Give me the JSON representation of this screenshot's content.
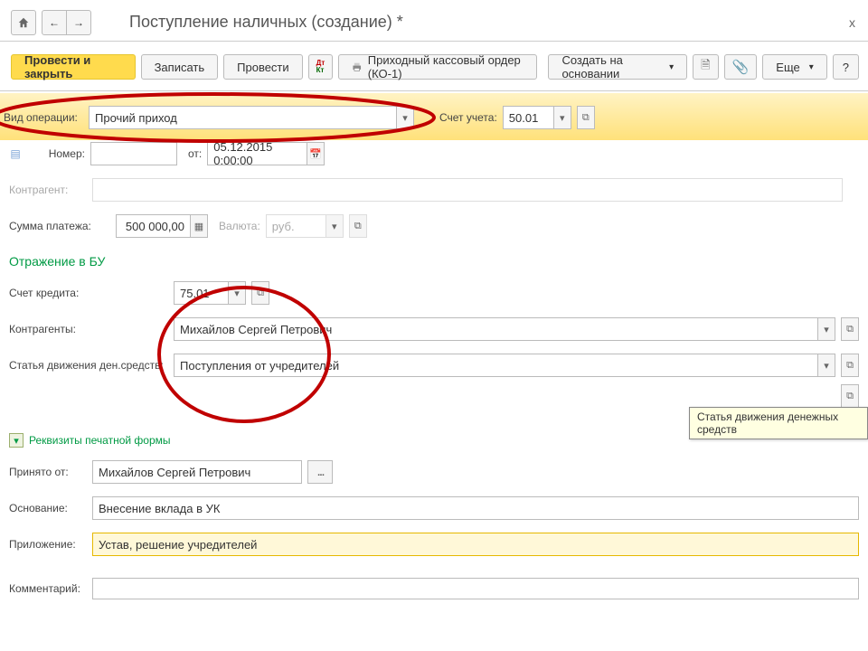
{
  "title": "Поступление наличных (создание) *",
  "toolbar": {
    "post_and_close": "Провести и закрыть",
    "save": "Записать",
    "post": "Провести",
    "print_order": "Приходный кассовый ордер (КО-1)",
    "create_based": "Создать на основании",
    "more": "Еще",
    "help": "?"
  },
  "labels": {
    "operation_type": "Вид операции:",
    "account": "Счет учета:",
    "number": "Номер:",
    "from": "от:",
    "counterparty": "Контрагент:",
    "amount": "Сумма платежа:",
    "currency": "Валюта:",
    "section_accounting": "Отражение в БУ",
    "credit_account": "Счет кредита:",
    "counterparties": "Контрагенты:",
    "cashflow_item": "Статья движения ден.средств:",
    "print_requisites": "Реквизиты печатной формы",
    "received_from": "Принято от:",
    "basis": "Основание:",
    "attachment": "Приложение:",
    "comment": "Комментарий:"
  },
  "values": {
    "operation_type": "Прочий приход",
    "account": "50.01",
    "number": "",
    "date": "05.12.2015  0:00:00",
    "counterparty": "",
    "amount": "500 000,00",
    "currency": "руб.",
    "credit_account": "75.01",
    "counterparties": "Михайлов Сергей Петрович",
    "cashflow_item": "Поступления от учредителей",
    "received_from": "Михайлов Сергей Петрович",
    "basis": "Внесение вклада в УК",
    "attachment": "Устав, решение учредителей",
    "comment": ""
  },
  "tooltip": "Статья движения денежных средств"
}
